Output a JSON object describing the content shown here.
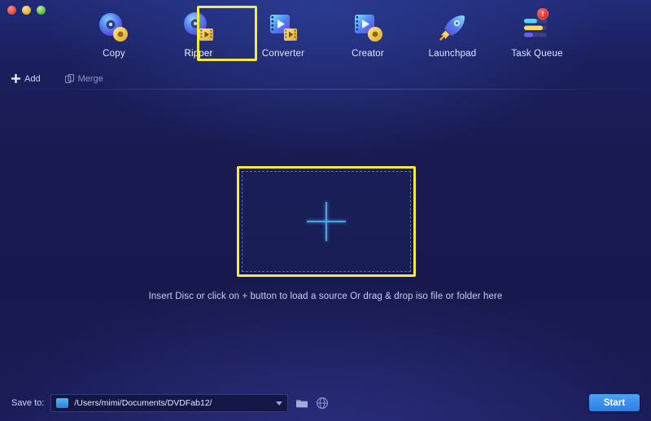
{
  "window": {
    "traffic_lights": [
      {
        "name": "close",
        "color": "#e0443a"
      },
      {
        "name": "minimize",
        "color": "#e0b32c"
      },
      {
        "name": "zoom",
        "color": "#55b843"
      }
    ]
  },
  "topnav": {
    "items": [
      {
        "label": "Copy",
        "icon": "disc-gear-icon",
        "active": false
      },
      {
        "label": "Ripper",
        "icon": "disc-film-icon",
        "active": true
      },
      {
        "label": "Converter",
        "icon": "film-play-icon",
        "active": false
      },
      {
        "label": "Creator",
        "icon": "film-disc-icon",
        "active": false
      },
      {
        "label": "Launchpad",
        "icon": "rocket-icon",
        "active": false
      },
      {
        "label": "Task Queue",
        "icon": "task-bars-icon",
        "active": false,
        "badge": "!"
      }
    ]
  },
  "subbar": {
    "add_label": "Add",
    "merge_label": "Merge"
  },
  "main": {
    "hint": "Insert Disc or click on + button to load a source Or drag & drop iso file or folder here",
    "plus_icon": "plus-icon"
  },
  "bottombar": {
    "save_to_label": "Save to:",
    "path_value": "/Users/mimi/Documents/DVDFab12/",
    "path_placeholder": "/Users/mimi/Documents/DVDFab12/",
    "dropdown_icon": "chevron-down-icon",
    "browse_icon": "folder-icon",
    "online_icon": "globe-icon",
    "start_label": "Start"
  },
  "annotations": {
    "highlight_color": "#f6ec33",
    "ripper_highlight": "ripper-nav-item",
    "dropzone_highlight": "source-dropzone"
  },
  "colors": {
    "accent": "#4aa3f5",
    "background": "#181a50",
    "header": "#212b77",
    "highlight": "#f6ec33",
    "badge": "#d52a22"
  }
}
